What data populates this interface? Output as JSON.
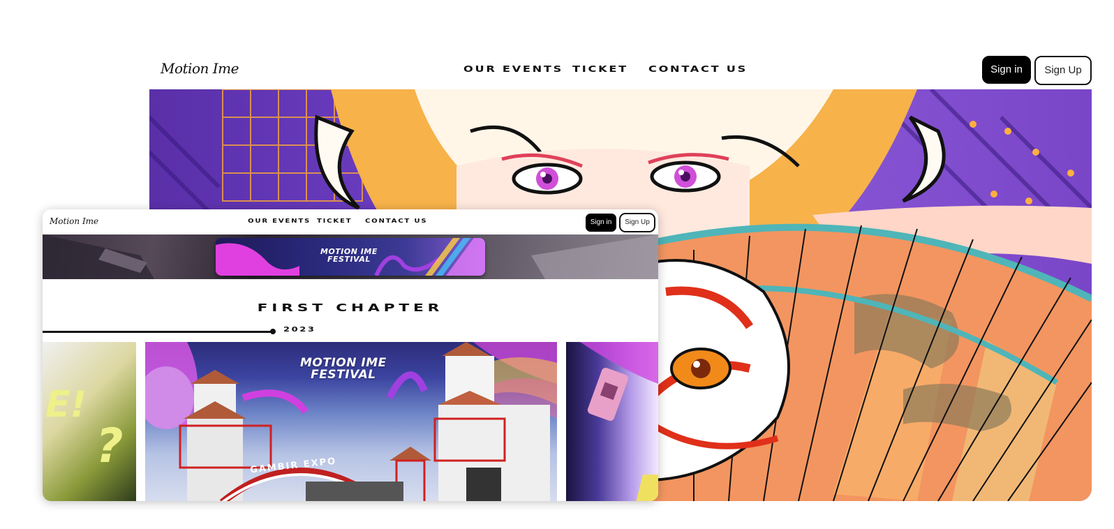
{
  "back_page": {
    "logo": "Motion Ime",
    "nav_links": [
      "Our Events",
      "Ticket",
      "Contact Us"
    ],
    "sign_in_label": "Sign in",
    "sign_up_label": "Sign Up"
  },
  "front_page": {
    "logo": "Motion Ime",
    "nav_links": [
      "Our Events",
      "Ticket",
      "Contact Us"
    ],
    "sign_in_label": "Sign in",
    "sign_up_label": "Sign Up",
    "banner_title_line1": "MOTION IME",
    "banner_title_line2": "FESTIVAL",
    "chapter_title": "First Chapter",
    "timeline_year": "2023",
    "slide_title_line1": "MOTION IME",
    "slide_title_line2": "FESTIVAL",
    "expo_sign": "GAMBIR EXPO",
    "left_slide_text": "E!",
    "left_slide_text2": "?"
  },
  "colors": {
    "button_dark": "#000000",
    "hero_purple": "#6d3fc4",
    "hair_orange": "#f7b24a",
    "fan_orange": "#f39560",
    "fan_teal": "#4fb5b8",
    "eye_magenta": "#d04fd8"
  }
}
